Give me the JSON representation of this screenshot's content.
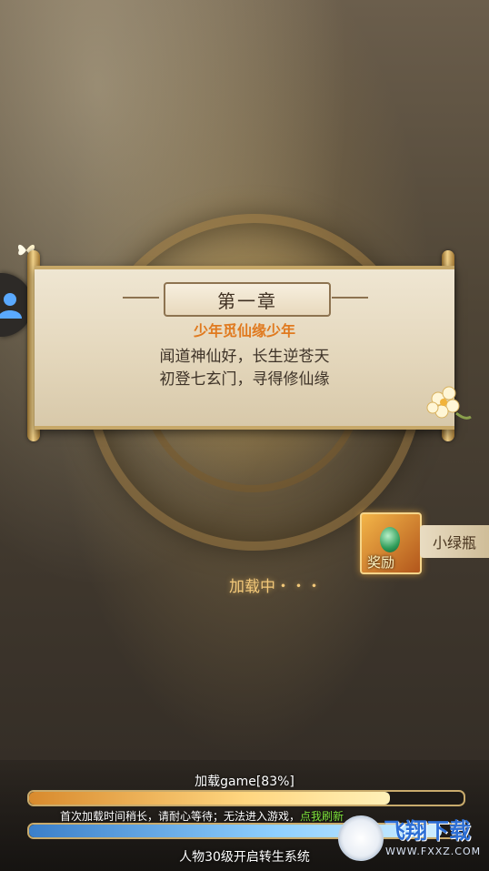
{
  "chapter": {
    "title": "第一章",
    "subtitle": "少年觅仙缘少年",
    "line1": "闻道神仙好，长生逆苍天",
    "line2": "初登七玄门，寻得修仙缘"
  },
  "reward": {
    "label": "奖励",
    "title": "小绿瓶"
  },
  "loading": {
    "text": "加载中・・・",
    "progress_label": "加载game[83%]",
    "progress_fraction": 0.83,
    "second_bar_fraction": 0.95,
    "notice": "首次加载时间稍长，请耐心等待；无法进入游戏，",
    "refresh_link": "点我刷新",
    "system_text": "人物30级开启转生系统"
  },
  "watermark": {
    "brand": "飞翔下载",
    "site": "WWW.FXXZ.COM"
  },
  "colors": {
    "accent_orange": "#e07a1f",
    "link_green": "#7ee23b",
    "loading_gold": "#f2c879"
  },
  "icons": {
    "avatar": "person-icon",
    "flower": "flower-icon",
    "butterfly": "butterfly-icon"
  }
}
